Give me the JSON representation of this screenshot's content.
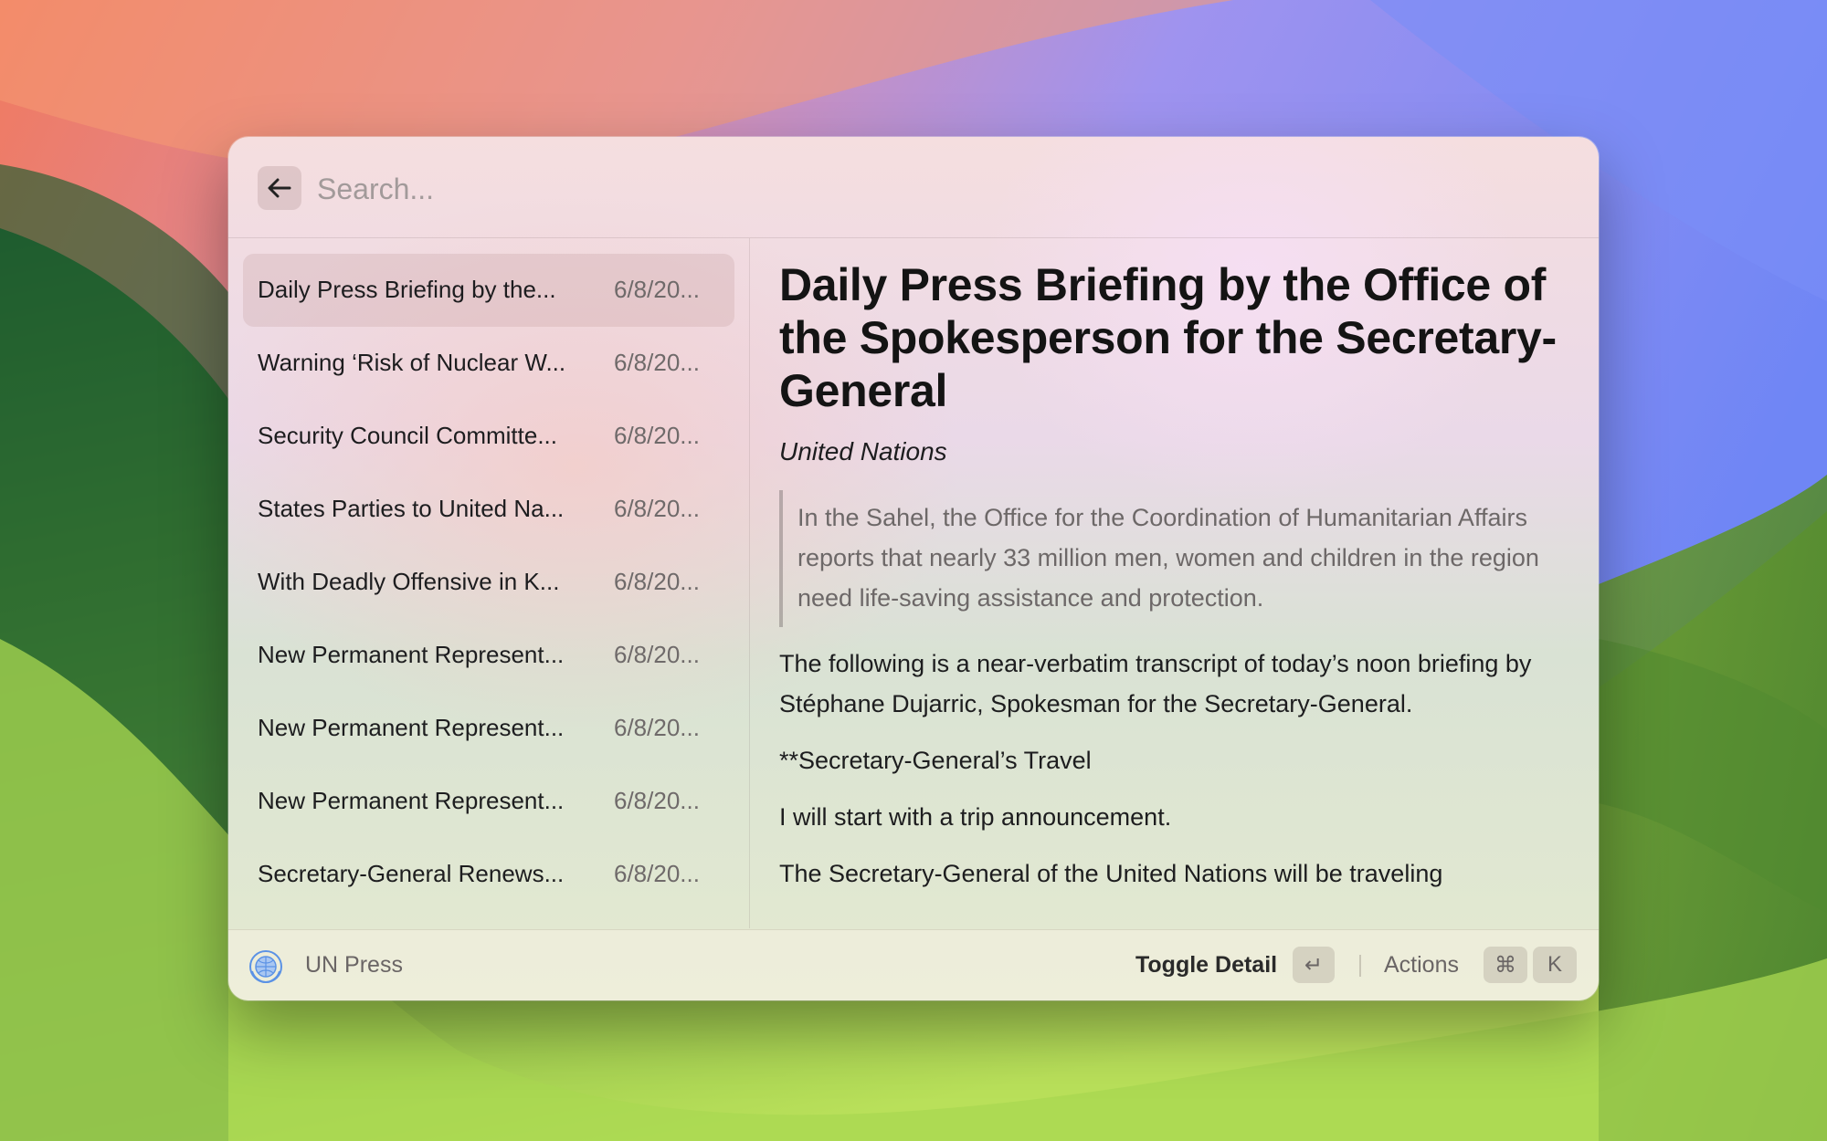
{
  "search": {
    "placeholder": "Search...",
    "value": ""
  },
  "list": {
    "items": [
      {
        "title": "Daily Press Briefing by the...",
        "date": "6/8/20...",
        "selected": true
      },
      {
        "title": "Warning ‘Risk of Nuclear W...",
        "date": "6/8/20..."
      },
      {
        "title": "Security Council Committe...",
        "date": "6/8/20..."
      },
      {
        "title": "States Parties to United Na...",
        "date": "6/8/20..."
      },
      {
        "title": "With Deadly Offensive in K...",
        "date": "6/8/20..."
      },
      {
        "title": "New Permanent Represent...",
        "date": "6/8/20..."
      },
      {
        "title": "New Permanent Represent...",
        "date": "6/8/20..."
      },
      {
        "title": "New Permanent Represent...",
        "date": "6/8/20..."
      },
      {
        "title": "Secretary-General Renews...",
        "date": "6/8/20..."
      }
    ]
  },
  "detail": {
    "title": "Daily Press Briefing by the Office of the Spokesperson for the Secretary-General",
    "source": "United Nations",
    "quote": "In the Sahel, the Office for the Coordination of Humanitarian Affairs reports that nearly 33 million men, women and children in the region need life-saving assistance and protection.",
    "paragraphs": [
      "The following is a near-verbatim transcript of today’s noon briefing by Stéphane Dujarric, Spokesman for the Secretary-General.",
      "**Secretary-General’s Travel",
      "I will start with a trip announcement.",
      "The Secretary-General of the United Nations will be traveling"
    ]
  },
  "footer": {
    "extension_name": "UN Press",
    "extension_icon": "un-emblem-icon",
    "primary_action": "Toggle Detail",
    "primary_key": "↵",
    "actions_label": "Actions",
    "actions_keys": [
      "⌘",
      "K"
    ]
  },
  "colors": {
    "accent_selected": "#d8bfc0",
    "text_primary": "#1d1d1f",
    "text_secondary": "#6d6868",
    "un_blue": "#5b92e5"
  }
}
